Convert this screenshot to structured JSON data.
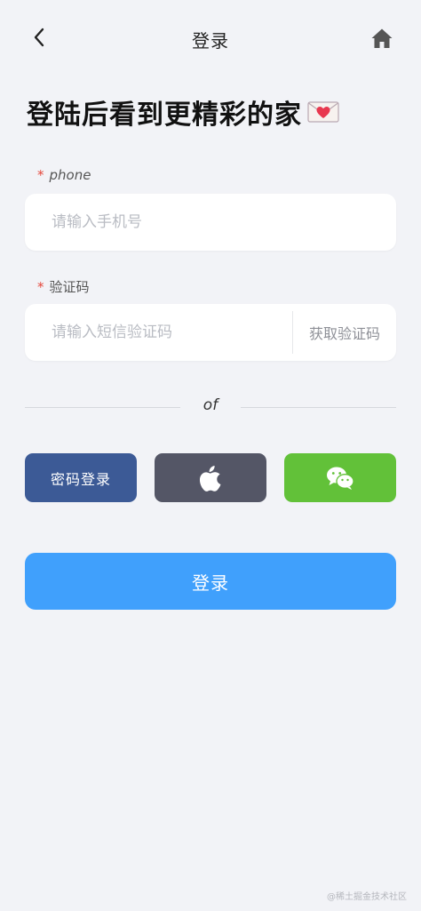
{
  "header": {
    "title": "登录",
    "back_icon": "chevron-left-icon",
    "home_icon": "home-icon"
  },
  "headline": {
    "text": "登陆后看到更精彩的家",
    "icon": "love-letter-icon"
  },
  "phone": {
    "required_mark": "*",
    "label": "phone",
    "placeholder": "请输入手机号",
    "value": ""
  },
  "code": {
    "required_mark": "*",
    "label": "验证码",
    "placeholder": "请输入短信验证码",
    "value": "",
    "get_code_label": "获取验证码"
  },
  "divider": {
    "text": "of"
  },
  "social": {
    "password_label": "密码登录",
    "apple_icon": "apple-icon",
    "wechat_icon": "wechat-icon"
  },
  "login_button": {
    "label": "登录"
  },
  "watermark": {
    "text": "@稀土掘金技术社区"
  },
  "colors": {
    "background": "#f2f3f7",
    "primary": "#40a0fc",
    "password_button": "#3c5a96",
    "apple_button": "#545666",
    "wechat_button": "#62c139",
    "required": "#e5473b"
  }
}
